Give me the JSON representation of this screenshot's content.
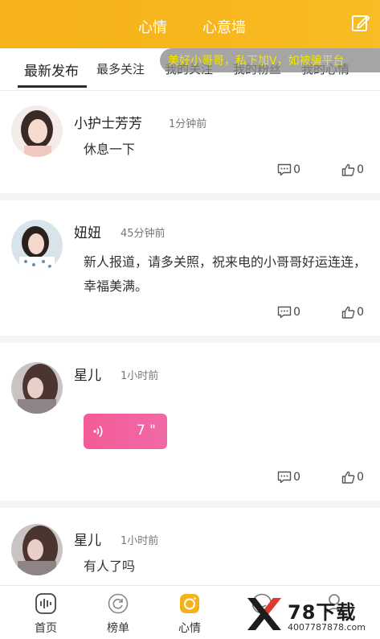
{
  "header": {
    "tabs": [
      "心情",
      "心意墙"
    ],
    "edit_icon": "edit-icon"
  },
  "subtabs": [
    "最新发布",
    "最多关注",
    "我的关注",
    "我的粉丝",
    "我的心情"
  ],
  "marquee": {
    "text": "美好小哥哥，私下加V，如被骗平台"
  },
  "posts": [
    {
      "username": "小护士芳芳",
      "time": "1分钟前",
      "content": "休息一下",
      "comments": "0",
      "likes": "0"
    },
    {
      "username": "妞妞",
      "time": "45分钟前",
      "content": "新人报道，请多关照，祝来电的小哥哥好运连连，幸福美满。",
      "comments": "0",
      "likes": "0"
    },
    {
      "username": "星儿",
      "time": "1小时前",
      "voice_duration": "7 \"",
      "comments": "0",
      "likes": "0"
    },
    {
      "username": "星儿",
      "time": "1小时前",
      "content": "有人了吗"
    }
  ],
  "bottom_nav": [
    {
      "label": "首页",
      "icon": "voice-wave-icon"
    },
    {
      "label": "榜单",
      "icon": "refresh-circle-icon"
    },
    {
      "label": "心情",
      "icon": "camera-icon",
      "active": true
    },
    {
      "label": "",
      "icon": "smile-icon"
    },
    {
      "label": "",
      "icon": "user-icon"
    }
  ],
  "watermark": {
    "text": "78下载",
    "sub": "4007787878.com"
  },
  "colors": {
    "header": "#f6b21a",
    "voice_bubble": "#f55a9a",
    "marquee_text": "#f5e600"
  }
}
